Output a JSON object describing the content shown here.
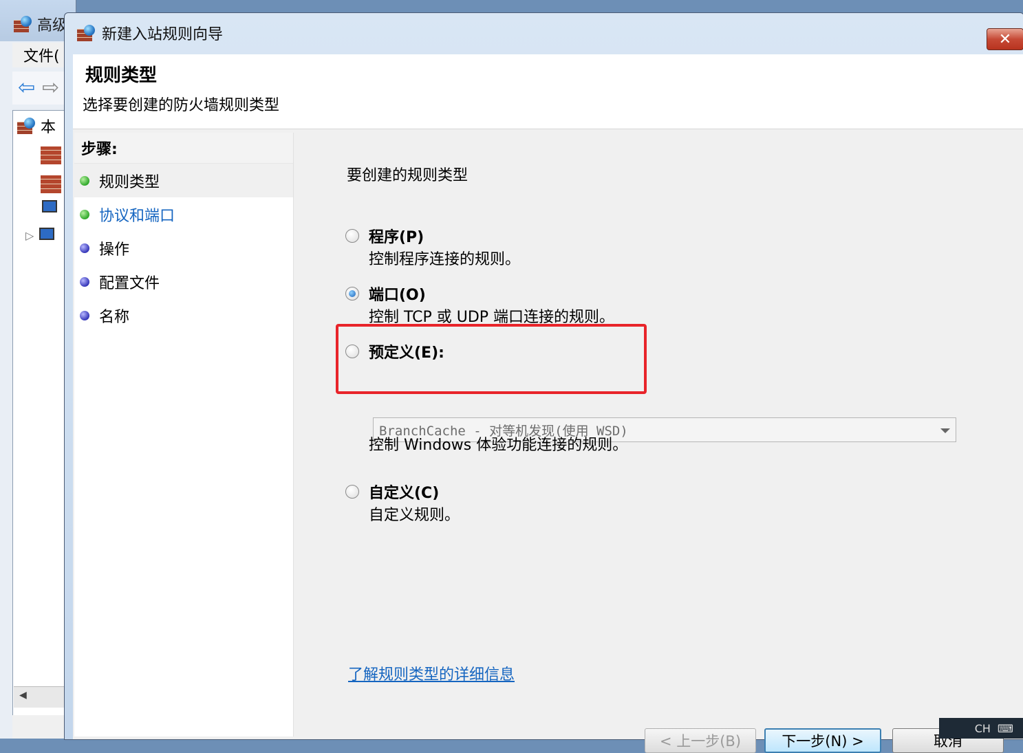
{
  "background_window": {
    "title": "高级",
    "menu_file": "文件(",
    "tree_root": "本"
  },
  "dialog": {
    "title": "新建入站规则向导",
    "close_glyph": "✕"
  },
  "header": {
    "title": "规则类型",
    "subtitle": "选择要创建的防火墙规则类型"
  },
  "steps": {
    "heading": "步骤:",
    "items": [
      {
        "label": "规则类型",
        "state": "current",
        "dot": "green"
      },
      {
        "label": "协议和端口",
        "state": "link",
        "dot": "green"
      },
      {
        "label": "操作",
        "state": "pending",
        "dot": "blue"
      },
      {
        "label": "配置文件",
        "state": "pending",
        "dot": "blue"
      },
      {
        "label": "名称",
        "state": "pending",
        "dot": "blue"
      }
    ]
  },
  "content": {
    "question": "要创建的规则类型",
    "options": [
      {
        "title": "程序(P)",
        "desc": "控制程序连接的规则。",
        "selected": false
      },
      {
        "title": "端口(O)",
        "desc": "控制 TCP 或 UDP 端口连接的规则。",
        "selected": true
      },
      {
        "title": "预定义(E):",
        "desc": "控制 Windows 体验功能连接的规则。",
        "selected": false
      },
      {
        "title": "自定义(C)",
        "desc": "自定义规则。",
        "selected": false
      }
    ],
    "predefined_select_value": "BranchCache - 对等机发现(使用 WSD)",
    "learn_more_link": "了解规则类型的详细信息",
    "highlight_color": "#e8242a"
  },
  "buttons": {
    "back": "< 上一步(B)",
    "next": "下一步(N) >",
    "cancel": "取消"
  },
  "taskbar": {
    "lang": "CH"
  }
}
